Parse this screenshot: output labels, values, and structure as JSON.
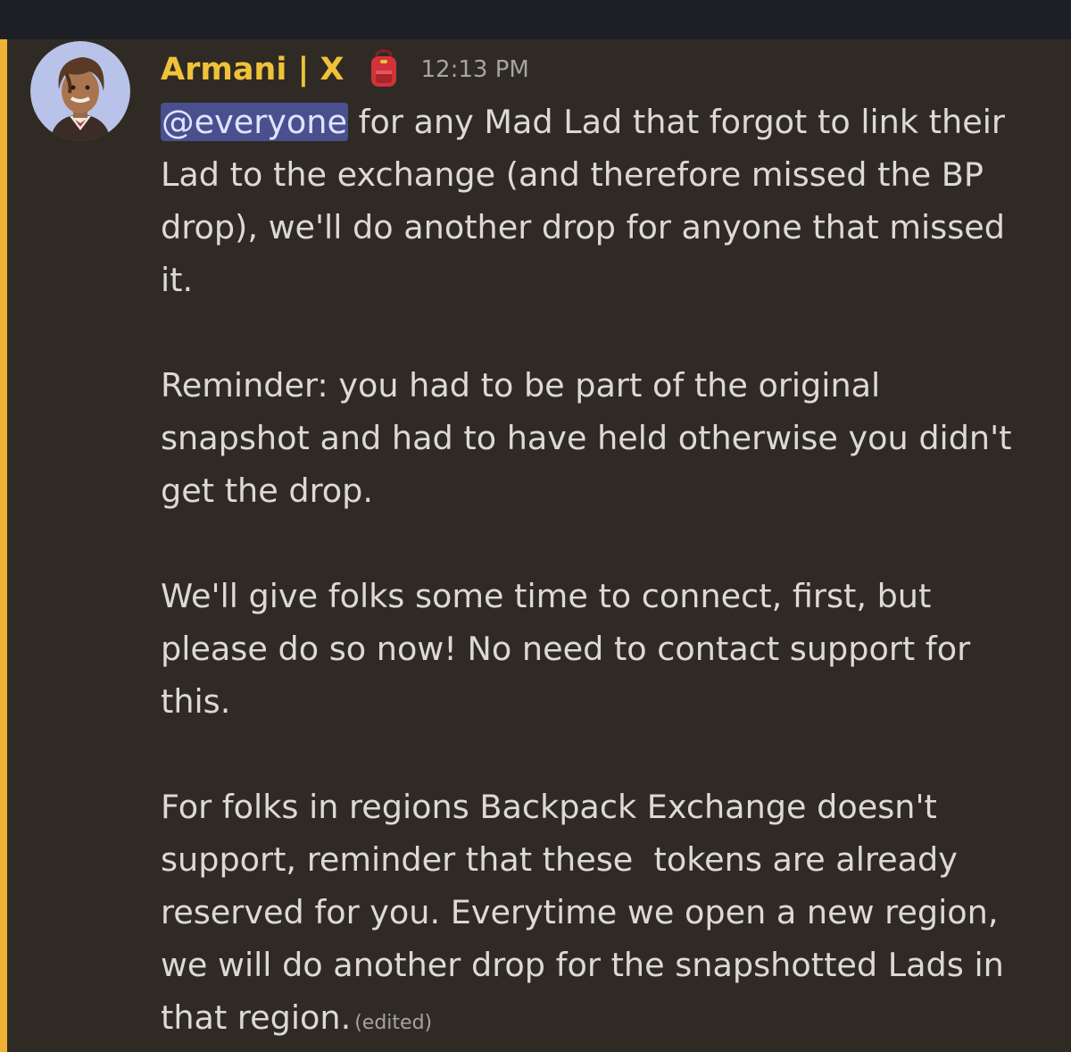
{
  "message": {
    "author": "Armani | X",
    "role_icon": "backpack-icon",
    "timestamp": "12:13 PM",
    "mention": "@everyone",
    "paragraph1": " for any Mad Lad that forgot to link their\nLad to the exchange (and therefore missed the BP\ndrop), we'll do another drop for anyone that missed\nit.",
    "paragraph2": "Reminder: you had to be part of the original\nsnapshot and had to have held otherwise you didn't\nget the drop.",
    "paragraph3": "We'll give folks some time to connect, first, but\nplease do so now! No need to contact support for\nthis.",
    "paragraph4": "For folks in regions Backpack Exchange doesn't\nsupport, reminder that these  tokens are already\nreserved for you. Everytime we open a new region,\nwe will do another drop for the snapshotted Lads in\nthat region.",
    "edited_label": "(edited)"
  },
  "colors": {
    "background": "#2f2b24",
    "highlight_bar": "#f0b232",
    "username": "#f0c23a",
    "mention_bg": "#4a4f8e",
    "text": "#dcdad2",
    "muted": "#a5a49d"
  }
}
